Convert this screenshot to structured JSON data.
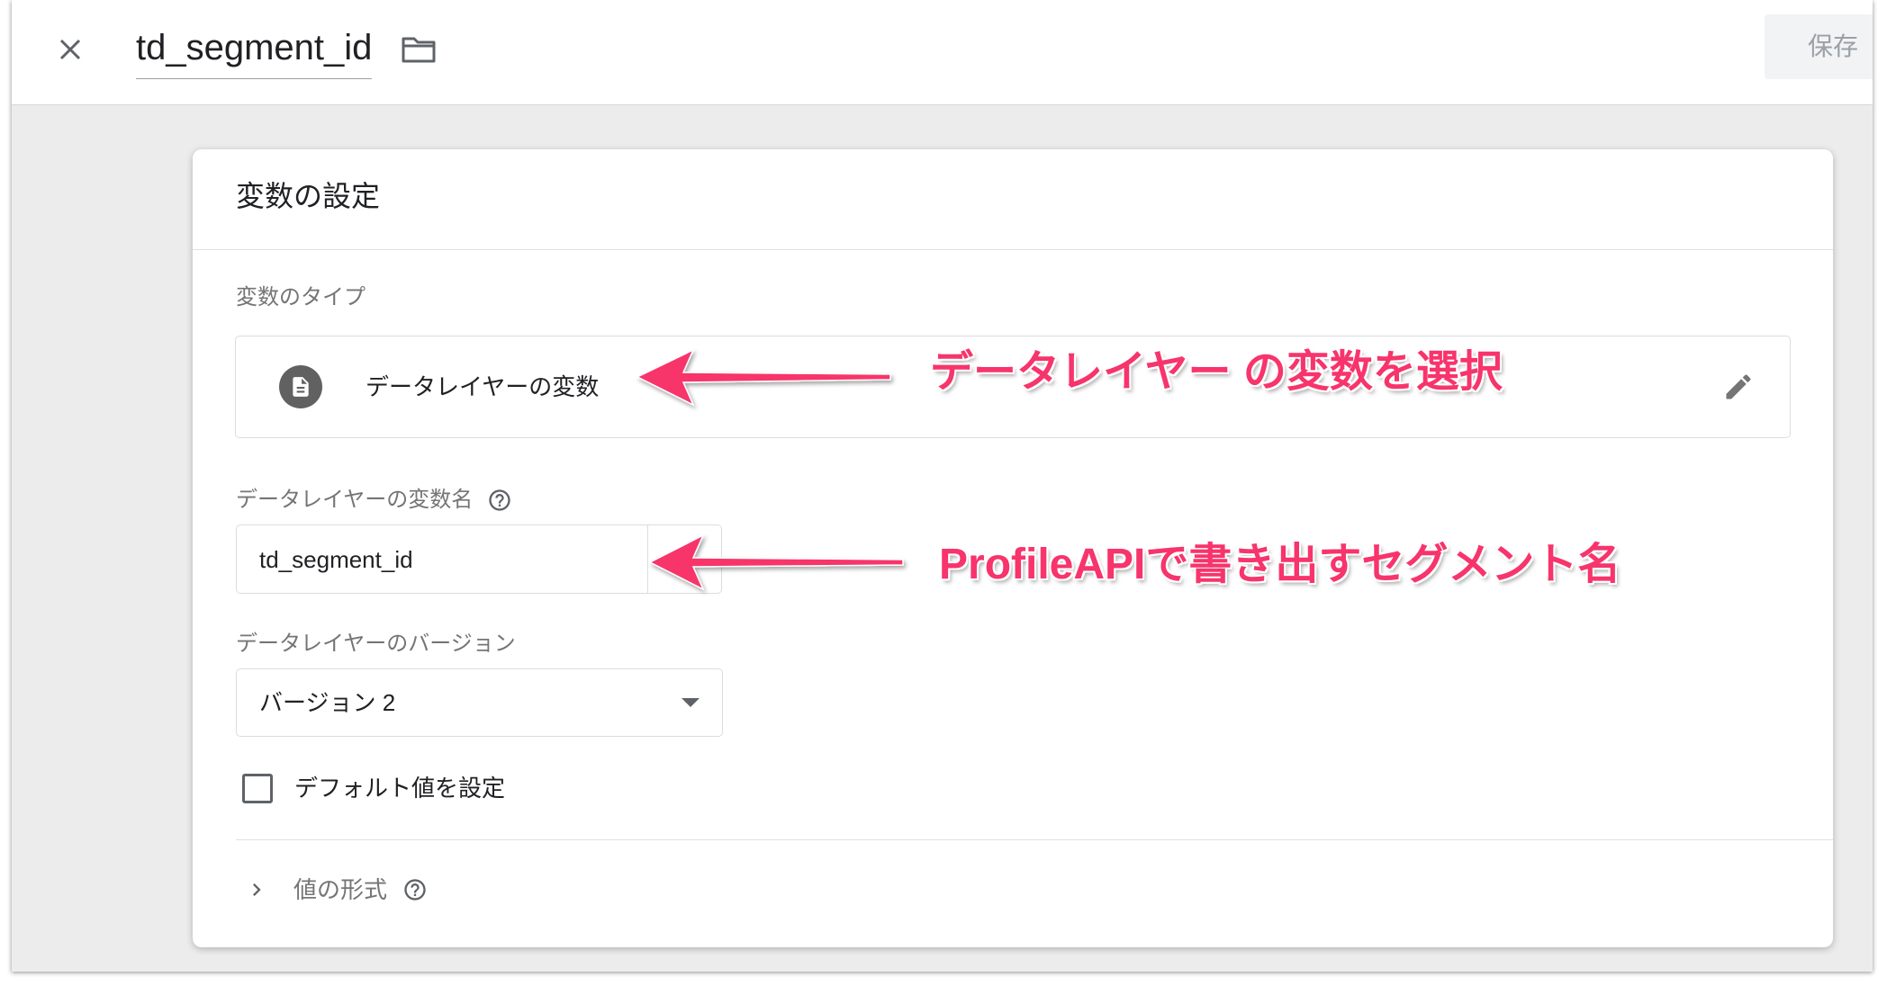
{
  "header": {
    "close_icon": "close-icon",
    "title": "td_segment_id",
    "folder_icon": "folder-icon",
    "save_label": "保存"
  },
  "card": {
    "title": "変数の設定",
    "type_section": {
      "label": "変数のタイプ",
      "type_name": "データレイヤーの変数",
      "type_icon": "document-icon",
      "edit_icon": "pencil-icon"
    },
    "variable_name": {
      "label": "データレイヤーの変数名",
      "value": "td_segment_id",
      "help_icon": "help-icon"
    },
    "version": {
      "label": "データレイヤーのバージョン",
      "selected": "バージョン 2",
      "dropdown_icon": "dropdown-arrow-icon"
    },
    "default_value": {
      "label": "デフォルト値を設定",
      "checked": false
    },
    "format": {
      "label": "値の形式",
      "expanded": false,
      "chevron_icon": "chevron-right-icon",
      "help_icon": "help-icon"
    }
  },
  "annotations": [
    {
      "text": "データレイヤー の変数を選択"
    },
    {
      "text": "ProfileAPIで書き出すセグメント名"
    }
  ],
  "colors": {
    "annotation": "#f7346b",
    "text": "#202124",
    "secondary_text": "#757575",
    "icon": "#5f6368",
    "background": "#ececec"
  }
}
